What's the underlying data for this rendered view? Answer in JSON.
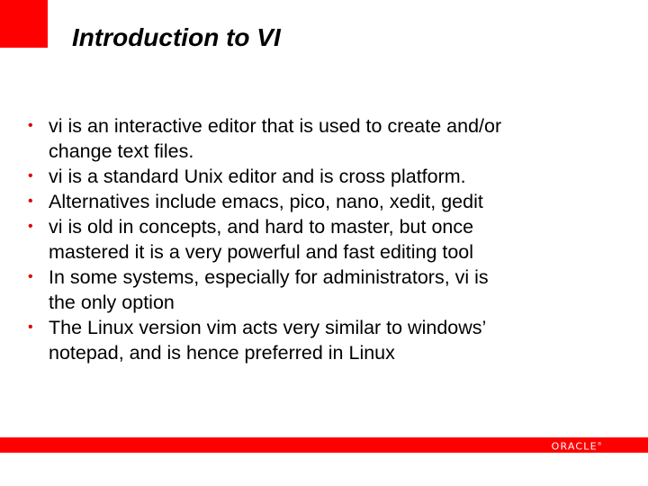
{
  "slide": {
    "title": "Introduction to VI",
    "bullet_glyph": "•",
    "bullets": [
      {
        "lines": [
          "vi is an interactive editor that is used to create and/or",
          "change text files."
        ]
      },
      {
        "lines": [
          "vi is a standard Unix editor and is cross platform."
        ]
      },
      {
        "lines": [
          "Alternatives include emacs, pico, nano, xedit, gedit"
        ]
      },
      {
        "lines": [
          "vi is old in concepts, and hard to master, but once",
          "mastered it is a very powerful and fast editing tool"
        ]
      },
      {
        "lines": [
          "In some systems, especially for administrators, vi is",
          "the only option"
        ]
      },
      {
        "lines": [
          "The Linux version vim acts very similar to windows’",
          "notepad, and is hence preferred in Linux"
        ]
      }
    ]
  },
  "footer": {
    "logo_text": "ORACLE",
    "logo_mark": "®"
  },
  "colors": {
    "accent": "#ff0000",
    "text": "#000000",
    "background": "#ffffff"
  }
}
